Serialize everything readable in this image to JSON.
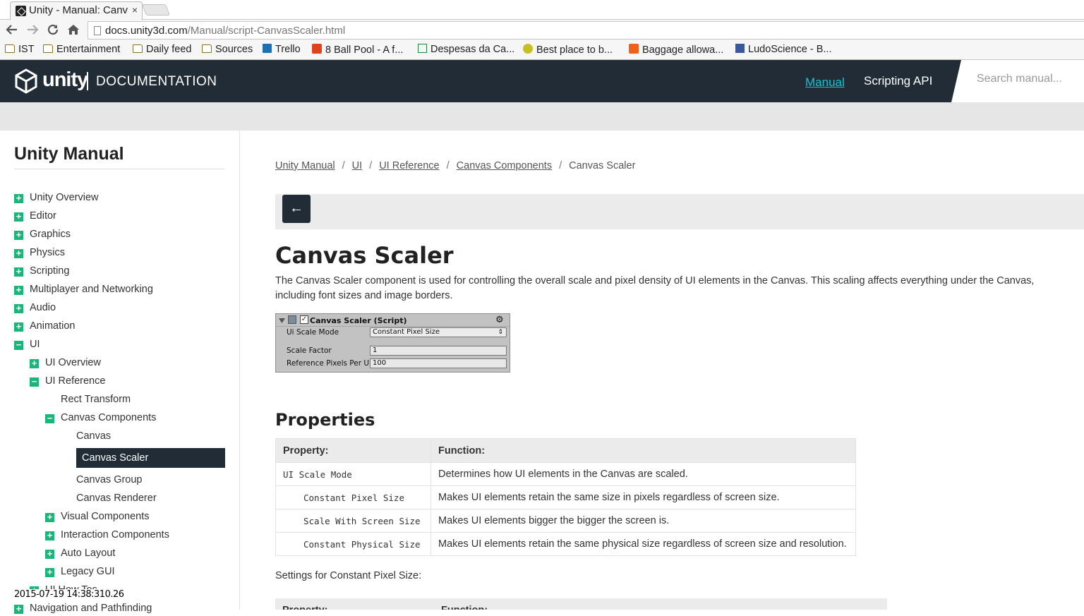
{
  "browser": {
    "tab_title": "Unity - Manual: Canv",
    "close_glyph": "×",
    "url_host": "docs.unity3d.com",
    "url_path": "/Manual/script-CanvasScaler.html",
    "bookmarks": [
      {
        "label": "IST",
        "icon": "folder-icon"
      },
      {
        "label": "Entertainment",
        "icon": "folder-icon"
      },
      {
        "label": "Daily feed",
        "icon": "folder-icon"
      },
      {
        "label": "Sources",
        "icon": "folder-icon"
      },
      {
        "label": "Trello",
        "icon": "trello-icon"
      },
      {
        "label": "8 Ball Pool - A f...",
        "icon": "play-icon"
      },
      {
        "label": "Despesas da Ca...",
        "icon": "sheet-icon"
      },
      {
        "label": "Best place to b...",
        "icon": "smiley-icon"
      },
      {
        "label": "Baggage allowa...",
        "icon": "e-icon"
      },
      {
        "label": "LudoScience - B...",
        "icon": "facebook-icon"
      }
    ]
  },
  "header": {
    "brand": "unity",
    "section": "DOCUMENTATION",
    "nav_manual": "Manual",
    "nav_api": "Scripting API",
    "search_placeholder": "Search manual..."
  },
  "sidebar": {
    "title": "Unity Manual",
    "items": [
      {
        "label": "Unity Overview",
        "toggle": "+"
      },
      {
        "label": "Editor",
        "toggle": "+"
      },
      {
        "label": "Graphics",
        "toggle": "+"
      },
      {
        "label": "Physics",
        "toggle": "+"
      },
      {
        "label": "Scripting",
        "toggle": "+"
      },
      {
        "label": "Multiplayer and Networking",
        "toggle": "+"
      },
      {
        "label": "Audio",
        "toggle": "+"
      },
      {
        "label": "Animation",
        "toggle": "+"
      },
      {
        "label": "UI",
        "toggle": "−"
      },
      {
        "label": "UI Overview",
        "toggle": "+"
      },
      {
        "label": "UI Reference",
        "toggle": "−"
      },
      {
        "label": "Rect Transform",
        "toggle": ""
      },
      {
        "label": "Canvas Components",
        "toggle": "−"
      },
      {
        "label": "Canvas",
        "toggle": ""
      },
      {
        "label": "Canvas Scaler",
        "toggle": ""
      },
      {
        "label": "Canvas Group",
        "toggle": ""
      },
      {
        "label": "Canvas Renderer",
        "toggle": ""
      },
      {
        "label": "Visual Components",
        "toggle": "+"
      },
      {
        "label": "Interaction Components",
        "toggle": "+"
      },
      {
        "label": "Auto Layout",
        "toggle": "+"
      },
      {
        "label": "Legacy GUI",
        "toggle": "+"
      },
      {
        "label": "UI How Tos",
        "toggle": "+"
      },
      {
        "label": "Navigation and Pathfinding",
        "toggle": "+"
      }
    ]
  },
  "timestamp": "2015-07-19 14:38:310.26",
  "breadcrumb": {
    "links": [
      "Unity Manual",
      "UI",
      "UI Reference",
      "Canvas Components"
    ],
    "separator": "/",
    "current": "Canvas Scaler"
  },
  "back_glyph": "←",
  "page": {
    "title": "Canvas Scaler",
    "intro": "The Canvas Scaler component is used for controlling the overall scale and pixel density of UI elements in the Canvas. This scaling affects everything under the Canvas, including font sizes and image borders.",
    "properties_heading": "Properties",
    "settings_line": "Settings for Constant Pixel Size:"
  },
  "inspector": {
    "title": "Canvas Scaler (Script)",
    "ui_scale_mode_label": "Ui Scale Mode",
    "ui_scale_mode_value": "Constant Pixel Size",
    "scale_factor_label": "Scale Factor",
    "scale_factor_value": "1",
    "ref_pixels_label": "Reference Pixels Per U",
    "ref_pixels_value": "100"
  },
  "properties_table": {
    "headers": [
      "Property:",
      "Function:"
    ],
    "rows": [
      {
        "property": "UI Scale Mode",
        "function": "Determines how UI elements in the Canvas are scaled.",
        "indent": false
      },
      {
        "property": "Constant Pixel Size",
        "function": "Makes UI elements retain the same size in pixels regardless of screen size.",
        "indent": true
      },
      {
        "property": "Scale With Screen Size",
        "function": "Makes UI elements bigger the bigger the screen is.",
        "indent": true
      },
      {
        "property": "Constant Physical Size",
        "function": "Makes UI elements retain the same physical size regardless of screen size and resolution.",
        "indent": true
      }
    ]
  },
  "settings_table": {
    "headers": [
      "Property:",
      "Function:"
    ]
  }
}
